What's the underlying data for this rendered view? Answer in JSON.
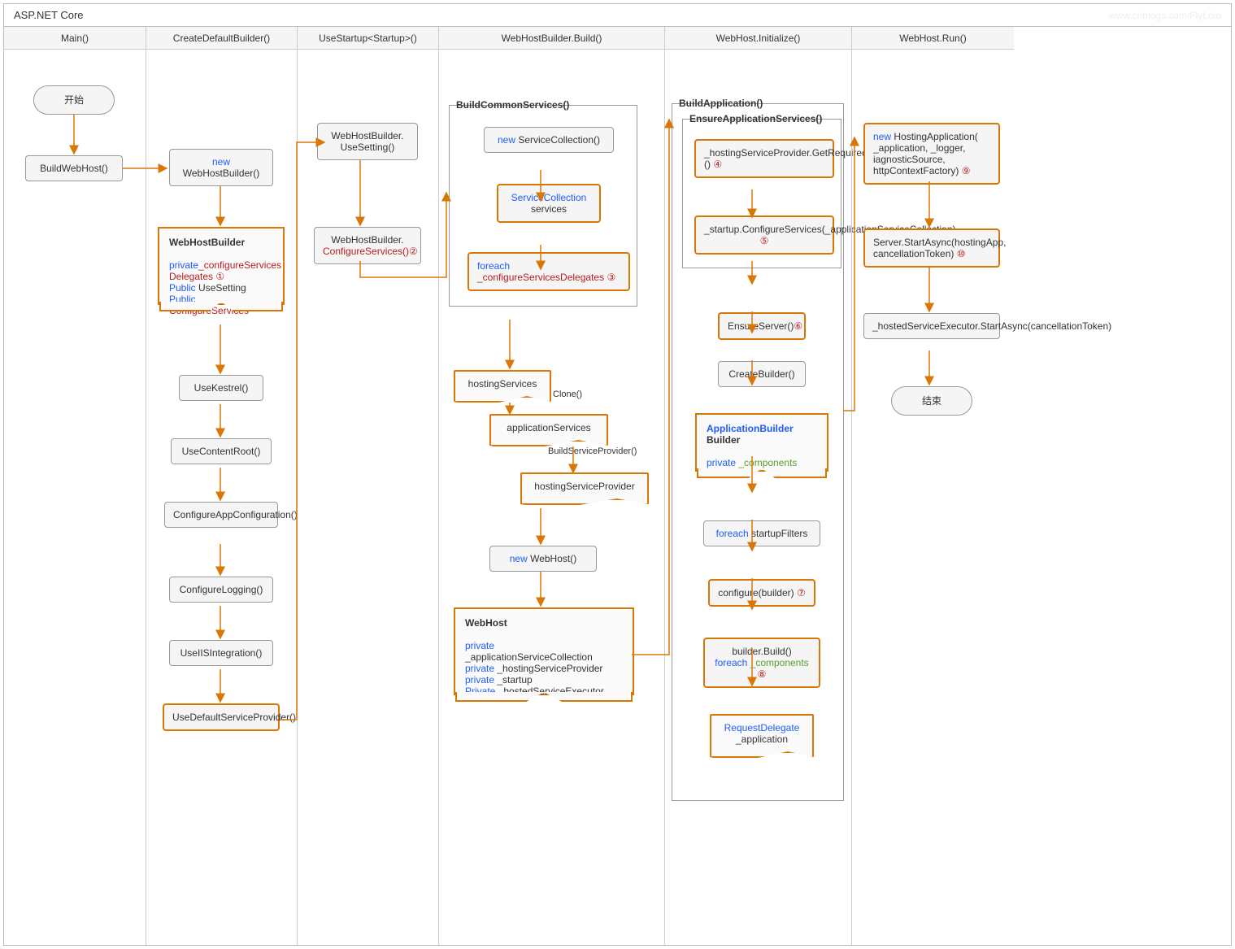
{
  "title": "ASP.NET Core",
  "watermark": "www.cnblogs.com/FlyLolo",
  "lanes": [
    "Main()",
    "CreateDefaultBuilder()",
    "UseStartup<Startup>()",
    "WebHostBuilder.Build()",
    "WebHost.Initialize()",
    "WebHost.Run()"
  ],
  "start": "开始",
  "end": "结束",
  "main": {
    "buildWebHost": "BuildWebHost()"
  },
  "cdb": {
    "newWHB_new": "new",
    "newWHB_label": "WebHostBuilder()",
    "note_title": "WebHostBuilder",
    "note_l1a": "private",
    "note_l1b": "_configureServices",
    "note_l1c": "Delegates",
    "note_l2a": "Public",
    "note_l2b": " UseSetting",
    "note_l3a": "Public",
    "note_l3b": " ConfigureServices",
    "useKestrel": "UseKestrel()",
    "useContentRoot": "UseContentRoot()",
    "configureAppConfig": "ConfigureAppConfiguration()",
    "configureLogging": "ConfigureLogging()",
    "useIIS": "UseIISIntegration()",
    "useDefaultSP": "UseDefaultServiceProvider()"
  },
  "us": {
    "useSetting_a": "WebHostBuilder.",
    "useSetting_b": "UseSetting()",
    "configServices_a": "WebHostBuilder.",
    "configServices_b": "ConfigureServices()"
  },
  "build": {
    "group": "BuildCommonServices()",
    "newSC_new": "new",
    "newSC_label": " ServiceCollection()",
    "scServices_a": "ServiceCollection",
    "scServices_b": "services",
    "foreach_a": "foreach",
    "foreach_b": "_configureServicesDelegates",
    "hostingServices": "hostingServices",
    "clone": "Clone()",
    "appServices": "applicationServices",
    "buildSP": "BuildServiceProvider()",
    "hostingSP": "hostingServiceProvider",
    "newWebHost_new": "new",
    "newWebHost_label": " WebHost()",
    "webhost_title": "WebHost",
    "wh_l1a": "private",
    "wh_l1b": "_applicationServiceCollection",
    "wh_l2a": "private",
    "wh_l2b": " _hostingServiceProvider",
    "wh_l3a": "private",
    "wh_l3b": " _startup",
    "wh_l4a": "Private",
    "wh_l4b": " _hostedServiceExecutor"
  },
  "init": {
    "group": "BuildApplication()",
    "subgroup": "EnsureApplicationServices()",
    "getRequired": "_hostingServiceProvider.GetRequiredService<IStartup>()",
    "startupCS": "_startup.ConfigureServices(_applicationServiceCollection)",
    "ensureServer": "EnsureServer()",
    "createBuilder": "CreateBuilder()",
    "ab_title": "ApplicationBuilder",
    "ab_sub": "Builder",
    "ab_l1a": "private",
    "ab_l1b": " _components",
    "foreachFilters_a": "foreach",
    "foreachFilters_b": " startupFilters",
    "configureBuilder": "configure(builder)",
    "builderBuild": "builder.Build()",
    "foreachComp_a": "foreach",
    "foreachComp_b": " _components",
    "rd_a": "RequestDelegate",
    "rd_b": "_application"
  },
  "run": {
    "newHA_new": "new",
    "newHA_a": " HostingApplication(",
    "newHA_b": "_application, _logger, iagnosticSource, httpContextFactory)",
    "serverStart": "Server.StartAsync(hostingApp, cancellationToken)",
    "hostedExec": "_hostedServiceExecutor.StartAsync(cancellationToken)"
  },
  "circled": {
    "1": "①",
    "2": "②",
    "3": "③",
    "4": "④",
    "5": "⑤",
    "6": "⑥",
    "7": "⑦",
    "8": "⑧",
    "9": "⑨",
    "10": "⑩"
  }
}
